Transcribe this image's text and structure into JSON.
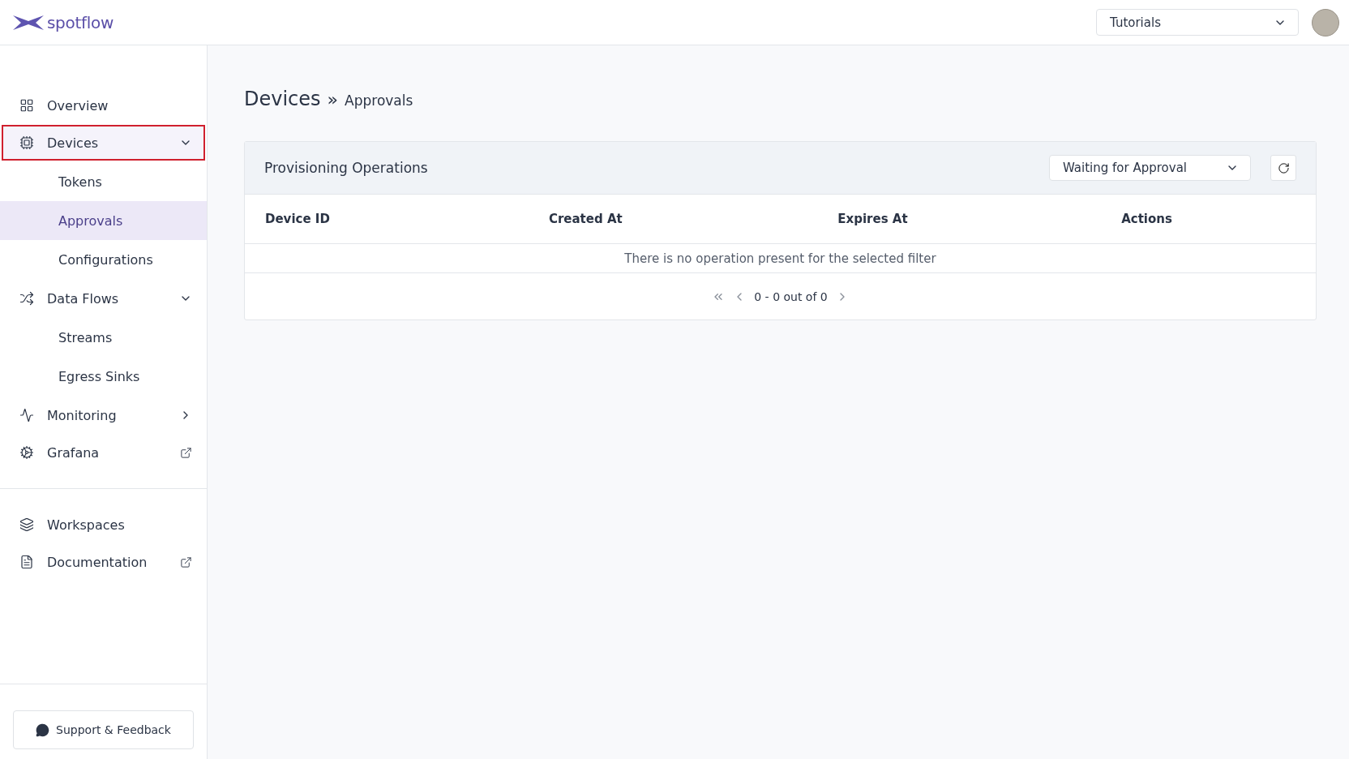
{
  "header": {
    "logo_text": "spotflow",
    "workspace_select": {
      "value": "Tutorials"
    }
  },
  "sidebar": {
    "items": [
      {
        "label": "Overview",
        "kind": "plain",
        "selected": false,
        "highlighted": false
      },
      {
        "label": "Devices",
        "kind": "group",
        "expanded": true,
        "selected": false,
        "highlighted": true,
        "children": [
          {
            "label": "Tokens",
            "selected": false
          },
          {
            "label": "Approvals",
            "selected": true
          },
          {
            "label": "Configurations",
            "selected": false
          }
        ]
      },
      {
        "label": "Data Flows",
        "kind": "group",
        "expanded": true,
        "selected": false,
        "highlighted": false,
        "children": [
          {
            "label": "Streams",
            "selected": false
          },
          {
            "label": "Egress Sinks",
            "selected": false
          }
        ]
      },
      {
        "label": "Monitoring",
        "kind": "group",
        "expanded": false,
        "selected": false,
        "highlighted": false
      },
      {
        "label": "Grafana",
        "kind": "external",
        "selected": false,
        "highlighted": false
      }
    ],
    "bottom_items": [
      {
        "label": "Workspaces",
        "kind": "plain"
      },
      {
        "label": "Documentation",
        "kind": "external"
      }
    ],
    "support_button": "Support & Feedback"
  },
  "breadcrumb": {
    "title": "Devices",
    "separator": "»",
    "current": "Approvals"
  },
  "card": {
    "title": "Provisioning Operations",
    "filter": {
      "value": "Waiting for Approval"
    },
    "table": {
      "columns": [
        "Device ID",
        "Created At",
        "Expires At",
        "Actions"
      ],
      "empty_message": "There is no operation present for the selected filter"
    },
    "pagination": {
      "range": "0 - 0 out of 0"
    }
  }
}
